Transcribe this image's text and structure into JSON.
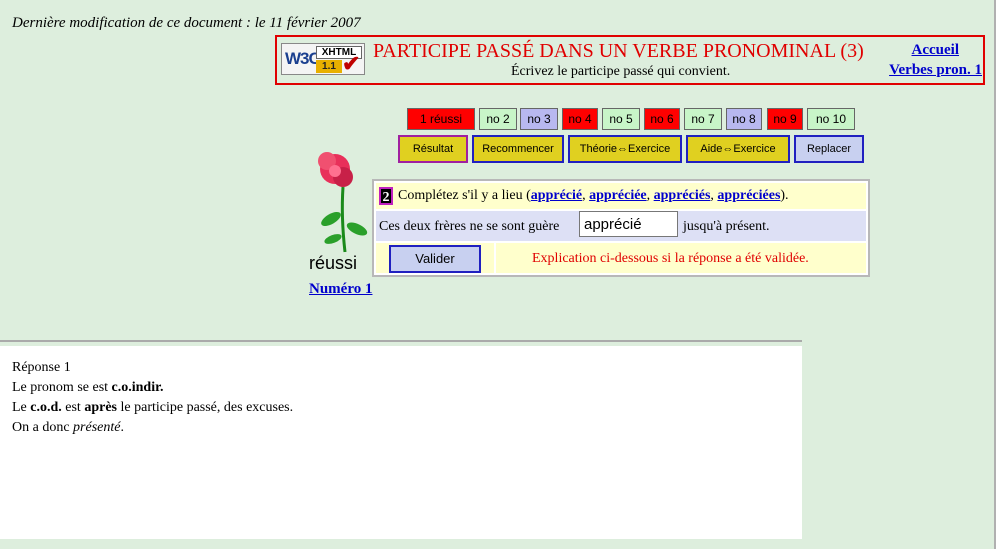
{
  "top_date": "Dernière modification de ce document : le 11 février 2007",
  "header": {
    "badge": {
      "w3c": "W3C",
      "xhtml": "XHTML",
      "version": "1.1",
      "check": "✔"
    },
    "title": "PARTICIPE PASSÉ DANS UN VERBE PRONOMINAL (3)",
    "subtitle": "Écrivez le participe passé qui convient.",
    "links": {
      "accueil": "Accueil",
      "verbes": "Verbes pron. 1"
    }
  },
  "number_buttons": [
    {
      "label": "1 réussi",
      "state": "red"
    },
    {
      "label": "no 2",
      "state": "green"
    },
    {
      "label": "no 3",
      "state": "blue"
    },
    {
      "label": "no 4",
      "state": "red"
    },
    {
      "label": "no 5",
      "state": "green"
    },
    {
      "label": "no 6",
      "state": "red"
    },
    {
      "label": "no 7",
      "state": "green"
    },
    {
      "label": "no 8",
      "state": "blue"
    },
    {
      "label": "no 9",
      "state": "red"
    },
    {
      "label": "no 10",
      "state": "green"
    }
  ],
  "action_buttons": {
    "resultat": "Résultat",
    "recommencer": "Recommencer",
    "theorie": "Théorie⇔Exercice",
    "aide": "Aide⇔Exercice",
    "replacer": "Replacer"
  },
  "status": {
    "reussi": "réussi",
    "numero_link": "Numéro 1"
  },
  "exercise": {
    "number": "2",
    "instruction_prefix": "Complétez s'il y a lieu (",
    "options": [
      "apprécié",
      "appréciée",
      "appréciés",
      "appréciées"
    ],
    "instruction_suffix": ").",
    "sentence_before": "Ces deux frères ne se sont guère",
    "answer_value": "apprécié",
    "sentence_after": "jusqu'à présent.",
    "validate_label": "Valider",
    "explanation_note": "Explication ci-dessous si la réponse a été validée."
  },
  "answer_panel": {
    "title": "Réponse 1",
    "line1_prefix": "Le pronom se est ",
    "line1_bold": "c.o.indir.",
    "line2_a": "Le ",
    "line2_b_bold": "c.o.d.",
    "line2_c": " est ",
    "line2_d_bold": "après",
    "line2_e": " le participe passé, des excuses.",
    "line3_prefix": "On a donc ",
    "line3_italic": "présenté",
    "line3_suffix": "."
  },
  "colors": {
    "red": "#ff0000",
    "green": "#c8f5c8",
    "blue": "#b8b8f0",
    "yellow": "#e0d020",
    "link": "#0000cc"
  }
}
